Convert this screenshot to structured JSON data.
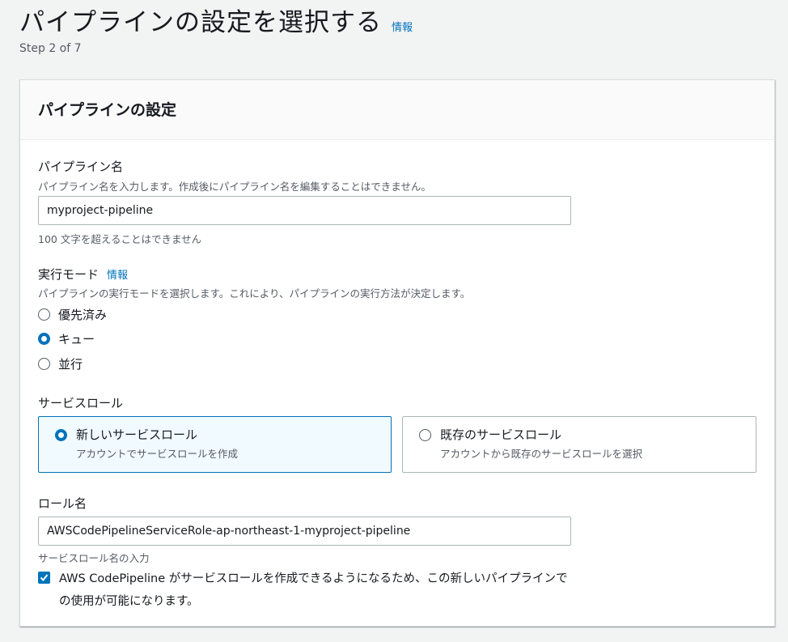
{
  "header": {
    "title": "パイプラインの設定を選択する",
    "info": "情報",
    "step": "Step 2 of 7"
  },
  "panel": {
    "title": "パイプラインの設定",
    "pipeline_name": {
      "label": "パイプライン名",
      "description": "パイプライン名を入力します。作成後にパイプライン名を編集することはできません。",
      "value": "myproject-pipeline",
      "constraint": "100 文字を超えることはできません"
    },
    "execution_mode": {
      "label": "実行モード",
      "info": "情報",
      "description": "パイプラインの実行モードを選択します。これにより、パイプラインの実行方法が決定します。",
      "options": [
        "優先済み",
        "キュー",
        "並行"
      ],
      "selected": "キュー"
    },
    "service_role": {
      "label": "サービスロール",
      "options": [
        {
          "title": "新しいサービスロール",
          "description": "アカウントでサービスロールを作成",
          "selected": true
        },
        {
          "title": "既存のサービスロール",
          "description": "アカウントから既存のサービスロールを選択",
          "selected": false
        }
      ]
    },
    "role_name": {
      "label": "ロール名",
      "value": "AWSCodePipelineServiceRole-ap-northeast-1-myproject-pipeline",
      "hint": "サービスロール名の入力"
    },
    "consent": {
      "checked": true,
      "text": "AWS CodePipeline がサービスロールを作成できるようになるため、この新しいパイプラインでの使用が可能になります。"
    }
  },
  "colors": {
    "accent": "#0073bb",
    "background": "#f2f3f3",
    "selected_tile": "#f1faff"
  }
}
